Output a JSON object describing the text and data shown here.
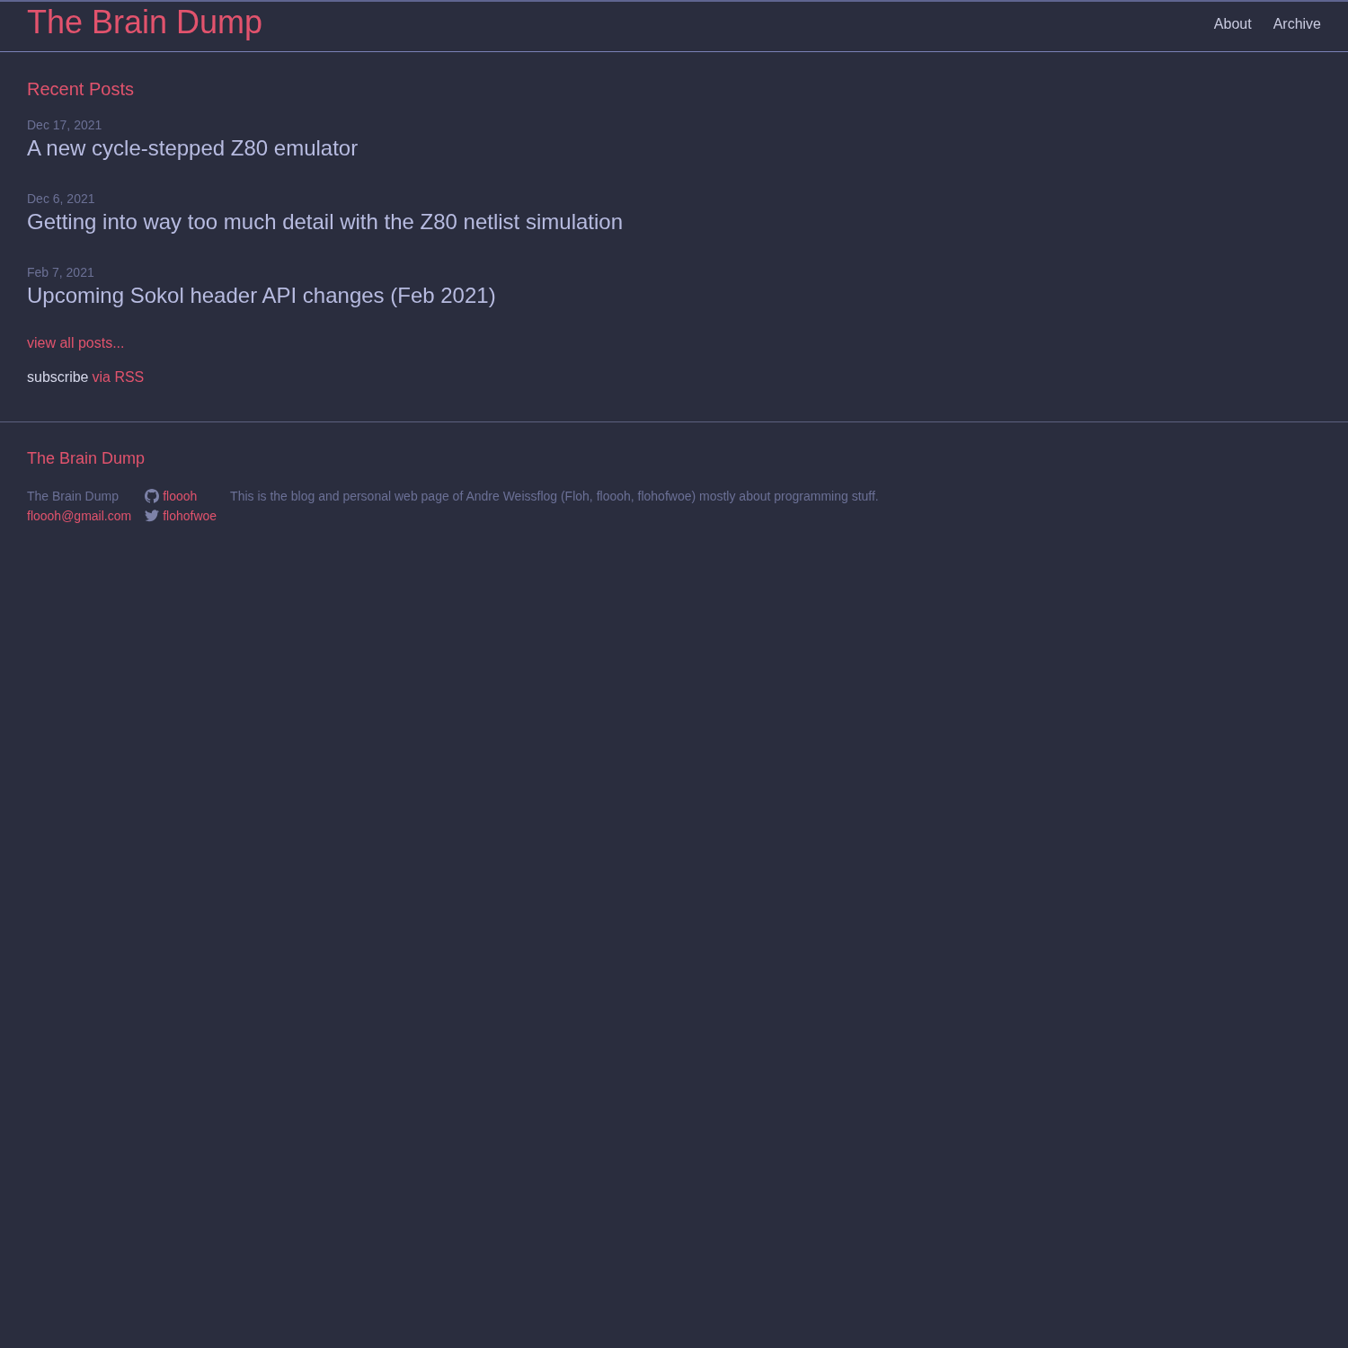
{
  "header": {
    "title": "The Brain Dump",
    "nav": [
      {
        "label": "About"
      },
      {
        "label": "Archive"
      }
    ]
  },
  "recent": {
    "heading": "Recent Posts",
    "posts": [
      {
        "date": "Dec 17, 2021",
        "title": "A new cycle-stepped Z80 emulator"
      },
      {
        "date": "Dec 6, 2021",
        "title": "Getting into way too much detail with the Z80 netlist simulation"
      },
      {
        "date": "Feb 7, 2021",
        "title": "Upcoming Sokol header API changes (Feb 2021)"
      }
    ],
    "view_all": "view all posts...",
    "subscribe": {
      "text": "subscribe",
      "link": "via RSS"
    }
  },
  "footer": {
    "heading": "The Brain Dump",
    "site_name": "The Brain Dump",
    "email": "floooh@gmail.com",
    "social": [
      {
        "kind": "github",
        "handle": "floooh"
      },
      {
        "kind": "twitter",
        "handle": "flohofwoe"
      }
    ],
    "description": "This is the blog and personal web page of Andre Weissflog (Floh, floooh, flohofwoe) mostly about programming stuff."
  }
}
